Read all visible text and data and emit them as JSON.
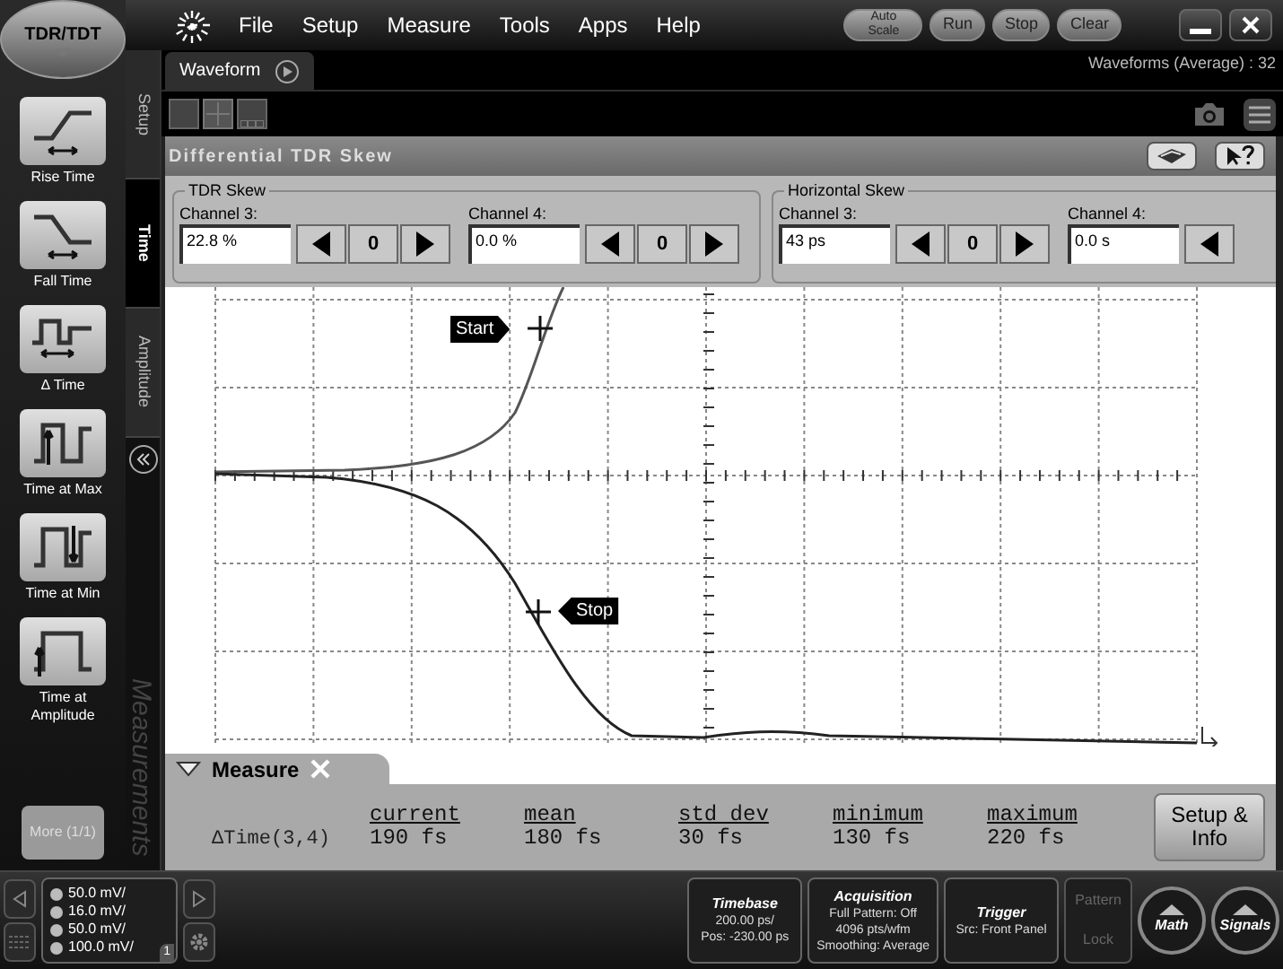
{
  "app": {
    "logo": "TDR/TDT"
  },
  "menu": [
    "File",
    "Setup",
    "Measure",
    "Tools",
    "Apps",
    "Help"
  ],
  "controls": [
    {
      "label": "Auto Scale",
      "kind": "small"
    },
    {
      "label": "Run",
      "kind": "normal"
    },
    {
      "label": "Stop",
      "kind": "normal"
    },
    {
      "label": "Clear",
      "kind": "normal"
    }
  ],
  "side_tabs": [
    {
      "label": "Setup",
      "selected": false
    },
    {
      "label": "Time",
      "selected": true
    },
    {
      "label": "Amplitude",
      "selected": false
    }
  ],
  "side_footer": "Measurements",
  "measurements": [
    {
      "label": "Rise Time",
      "kind": "rise"
    },
    {
      "label": "Fall Time",
      "kind": "fall"
    },
    {
      "label": "Δ Time",
      "kind": "delta"
    },
    {
      "label": "Time at Max",
      "kind": "max"
    },
    {
      "label": "Time at Min",
      "kind": "min"
    },
    {
      "label": "Time at Amplitude",
      "kind": "amplitude"
    }
  ],
  "more_button": {
    "label": "More (1/1)",
    "disabled": true
  },
  "tabs": [
    {
      "label": "Waveform",
      "selected": true
    }
  ],
  "waveform_count": "Waveforms (Average) : 32",
  "dialog": {
    "title": "Differential TDR Skew",
    "groups": [
      {
        "title": "TDR Skew",
        "channels": [
          {
            "label": "Channel 3:",
            "value": "22.8 %",
            "zero": "0"
          },
          {
            "label": "Channel 4:",
            "value": "0.0 %",
            "zero": "0"
          }
        ]
      },
      {
        "title": "Horizontal Skew",
        "channels": [
          {
            "label": "Channel 3:",
            "value": "43 ps",
            "zero": "0"
          },
          {
            "label": "Channel 4:",
            "value": "0.0 s"
          }
        ]
      }
    ]
  },
  "markers": [
    {
      "label": "Start",
      "kind": "start"
    },
    {
      "label": "Stop",
      "kind": "stop"
    }
  ],
  "measure": {
    "title": "Measure",
    "name": "ΔTime(3,4)",
    "button": "Setup & Info",
    "columns": [
      {
        "header": "current",
        "value": "190 fs"
      },
      {
        "header": "mean",
        "value": "180 fs"
      },
      {
        "header": "std dev",
        "value": "30 fs"
      },
      {
        "header": "minimum",
        "value": "130 fs"
      },
      {
        "header": "maximum",
        "value": "220 fs"
      }
    ]
  },
  "status": {
    "scales": [
      "50.0 mV/",
      "16.0 mV/",
      "50.0 mV/",
      "100.0 mV/"
    ],
    "page": "1",
    "panels": [
      {
        "title": "Timebase",
        "lines": [
          "200.00 ps/",
          "Pos: -230.00 ps"
        ]
      },
      {
        "title": "Acquisition",
        "lines": [
          "Full Pattern: Off",
          "4096 pts/wfm",
          "Smoothing: Average"
        ]
      },
      {
        "title": "Trigger",
        "lines": [
          "Src: Front Panel"
        ]
      }
    ],
    "pattern_lock": {
      "label": "Pattern Lock",
      "disabled": true
    },
    "round_buttons": [
      "Math",
      "Signals"
    ]
  }
}
